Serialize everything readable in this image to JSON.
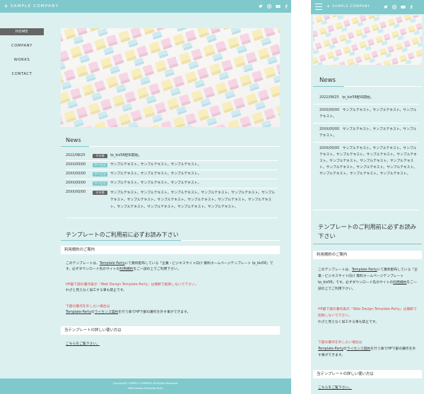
{
  "site": {
    "logo_mark": "+",
    "logo_text": "SAMPLE COMPANY",
    "nav": [
      {
        "label": "HOME",
        "active": true
      },
      {
        "label": "COMPANY"
      },
      {
        "label": "WORKS"
      },
      {
        "label": "CONTACT"
      }
    ],
    "sns_icons": [
      "twitter-icon",
      "instagram-icon",
      "youtube-icon",
      "facebook-icon"
    ]
  },
  "news": {
    "title": "News",
    "items": [
      {
        "date": "2022/08/25",
        "category": "その他",
        "category_type": "other",
        "text": "tp_biz58配布開始。"
      },
      {
        "date": "20XX/00/00",
        "category": "サービス",
        "category_type": "service",
        "text": "サンプルテキスト。サンプルテキスト。サンプルテキスト。"
      },
      {
        "date": "20XX/00/00",
        "category": "サービス",
        "category_type": "service",
        "text": "サンプルテキスト。サンプルテキスト。サンプルテキスト。"
      },
      {
        "date": "20XX/00/00",
        "category": "サービス",
        "category_type": "service",
        "text": "サンプルテキスト。サンプルテキスト。サンプルテキスト。"
      },
      {
        "date": "20XX/00/00",
        "category": "その他",
        "category_type": "other",
        "text": "サンプルテキスト。サンプルテキスト。サンプルテキスト。サンプルテキスト。サンプルテキスト。サンプルテキスト。サンプルテキスト。サンプルテキスト。サンプルテキスト。サンプルテキスト。サンプルテキスト。サンプルテキスト。サンプルテキスト。サンプルテキスト。サンプルテキスト。"
      }
    ]
  },
  "template": {
    "title": "テンプレートのご利用前に必ずお読み下さい",
    "terms_heading": "利用規約のご案内",
    "p1_a": "このテンプレートは、",
    "p1_link": "Template Party",
    "p1_b": "にて無料配布している「企業・ビジネスサイト向け 無料ホームページテンプレート tp_biz58」です。必ずダウンロード先のサイトの",
    "p1_link2": "利用規約",
    "p1_c": "をご一読の上でご利用下さい。",
    "p2_red": "HP最下部の著作表示『Web Design:Template-Party』は無断で削除しないで下さい。",
    "p2_b": "わざと見えなく加工する事も禁止です。",
    "p3_red": "下部の著作を外したい場合は",
    "p3_link": "Template-Party",
    "p3_b": "の",
    "p3_link2": "ライセンス契約",
    "p3_c": "を行う事でHP下部の著作を外す事ができます。",
    "usage_heading": "当テンプレートの詳しい使い方は",
    "usage_link": "こちらをご覧下さい。"
  },
  "footer": {
    "copyright": "Copyright© SAMPLE COMPANY All Rights Reserved.",
    "credit": "Web Design:Template-Party"
  }
}
